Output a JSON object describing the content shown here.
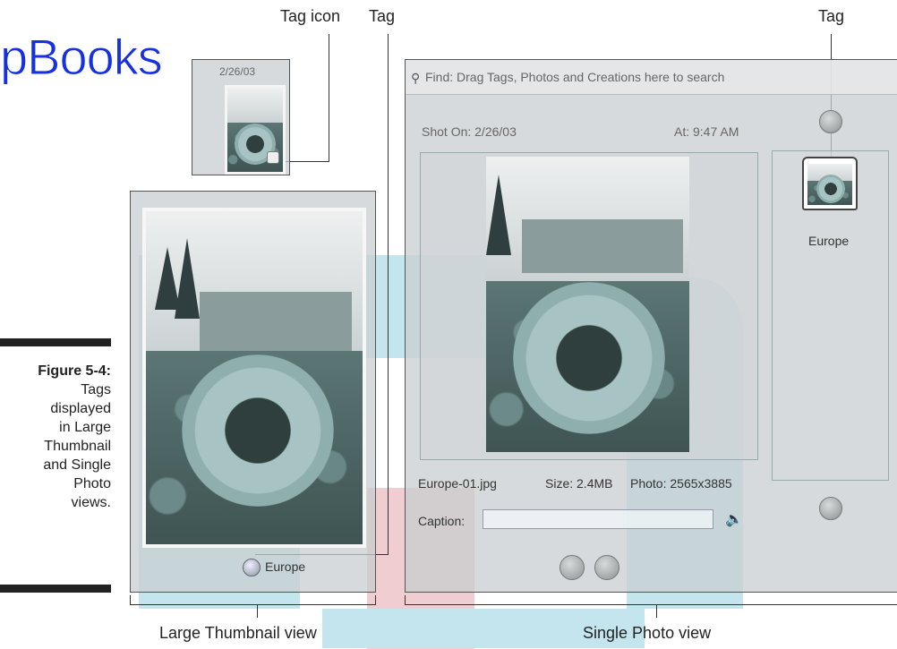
{
  "watermark": {
    "logo_text": "pBooks"
  },
  "callouts": {
    "tag_icon": "Tag icon",
    "tag_left": "Tag",
    "tag_right": "Tag",
    "large_thumbnail_view": "Large Thumbnail view",
    "single_photo_view": "Single Photo view"
  },
  "figure_caption": {
    "number": "Figure 5-4:",
    "lines": [
      "Tags",
      "displayed",
      "in Large",
      "Thumbnail",
      "and Single",
      "Photo",
      "views."
    ]
  },
  "small_thumb": {
    "date": "2/26/03"
  },
  "large_thumb": {
    "tag_name": "Europe"
  },
  "single_photo": {
    "find_bar": "Find: Drag Tags, Photos and Creations here to search",
    "shot_on": "Shot On: 2/26/03",
    "at_time": "At: 9:47 AM",
    "filename": "Europe-01.jpg",
    "size": "Size: 2.4MB",
    "photo_dims": "Photo: 2565x3885",
    "caption_label": "Caption:",
    "caption_value": "",
    "tag_name": "Europe"
  },
  "colors": {
    "watermark_blue": "#c4e5ee",
    "watermark_pink": "#f0cdd0",
    "logo_blue": "#1730e0"
  },
  "icons": [
    "binoculars-icon",
    "tag-icon",
    "speaker-icon",
    "scroll-up-icon",
    "scroll-down-icon",
    "previous-photo-icon",
    "next-photo-icon"
  ]
}
